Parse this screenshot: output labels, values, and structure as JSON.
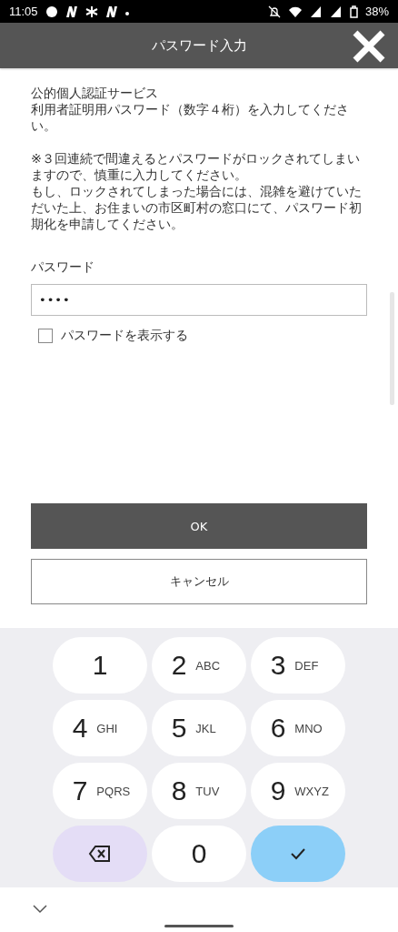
{
  "status_bar": {
    "time": "11:05",
    "battery": "38%"
  },
  "header": {
    "title": "パスワード入力"
  },
  "intro": [
    "公的個人認証サービス",
    "利用者証明用パスワード（数字４桁）を入力してください。"
  ],
  "notice": [
    "※３回連続で間違えるとパスワードがロックされてしまいますので、慎重に入力してください。",
    "もし、ロックされてしまった場合には、混雑を避けていただいた上、お住まいの市区町村の窓口にて、パスワード初期化を申請してください。"
  ],
  "password": {
    "label": "パスワード",
    "value": "••••"
  },
  "show_password": {
    "label": "パスワードを表示する",
    "checked": false
  },
  "buttons": [
    {
      "label": "OK",
      "kind": "primary"
    },
    {
      "label": "キャンセル",
      "kind": "secondary"
    }
  ],
  "keypad": [
    {
      "kind": "digit",
      "digit": "1"
    },
    {
      "kind": "digit",
      "digit": "2",
      "letters": "ABC"
    },
    {
      "kind": "digit",
      "digit": "3",
      "letters": "DEF"
    },
    {
      "kind": "digit",
      "digit": "4",
      "letters": "GHI"
    },
    {
      "kind": "digit",
      "digit": "5",
      "letters": "JKL"
    },
    {
      "kind": "digit",
      "digit": "6",
      "letters": "MNO"
    },
    {
      "kind": "digit",
      "digit": "7",
      "letters": "PQRS"
    },
    {
      "kind": "digit",
      "digit": "8",
      "letters": "TUV"
    },
    {
      "kind": "digit",
      "digit": "9",
      "letters": "WXYZ"
    },
    {
      "kind": "backspace"
    },
    {
      "kind": "digit",
      "digit": "0"
    },
    {
      "kind": "done"
    }
  ]
}
